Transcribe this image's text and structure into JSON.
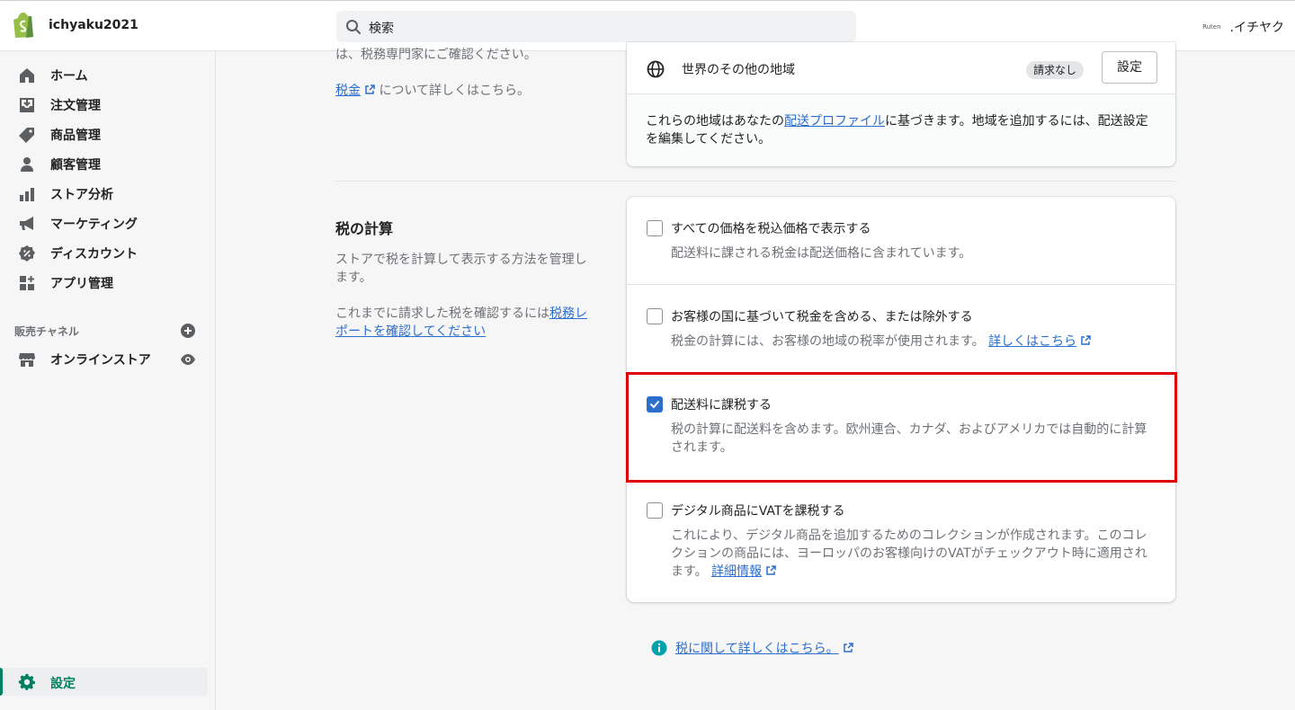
{
  "topbar": {
    "store_name": "ichyaku2021",
    "search_placeholder": "検索",
    "user_logo_text": "Ruten",
    "user_name": ".イチヤク"
  },
  "sidebar": {
    "items": [
      {
        "label": "ホーム",
        "icon": "home-icon"
      },
      {
        "label": "注文管理",
        "icon": "orders-icon"
      },
      {
        "label": "商品管理",
        "icon": "tag-icon"
      },
      {
        "label": "顧客管理",
        "icon": "customer-icon"
      },
      {
        "label": "ストア分析",
        "icon": "analytics-icon"
      },
      {
        "label": "マーケティング",
        "icon": "megaphone-icon"
      },
      {
        "label": "ディスカウント",
        "icon": "discount-icon"
      },
      {
        "label": "アプリ管理",
        "icon": "apps-icon"
      }
    ],
    "channels_title": "販売チャネル",
    "online_store": "オンラインストア",
    "settings": "設定"
  },
  "main": {
    "top_partial_text": "は、税務専門家にご確認ください。",
    "tax_link": "税金",
    "tax_link_suffix": "について詳しくはこちら。",
    "region": {
      "name": "世界のその他の地域",
      "badge": "請求なし",
      "button": "設定"
    },
    "region_note_pre": "これらの地域はあなたの",
    "region_note_link": "配送プロファイル",
    "region_note_post": "に基づきます。地域を追加するには、配送設定を編集してください。",
    "section_title": "税の計算",
    "section_desc": "ストアで税を計算して表示する方法を管理します。",
    "section_desc2_pre": "これまでに請求した税を確認するには",
    "section_desc2_link": "税務レポートを確認してください",
    "options": [
      {
        "label": "すべての価格を税込価格で表示する",
        "help": "配送料に課される税金は配送価格に含まれています。",
        "checked": false
      },
      {
        "label": "お客様の国に基づいて税金を含める、または除外する",
        "help": "税金の計算には、お客様の地域の税率が使用されます。",
        "link": "詳しくはこちら",
        "checked": false
      },
      {
        "label": "配送料に課税する",
        "help": "税の計算に配送料を含めます。欧州連合、カナダ、およびアメリカでは自動的に計算されます。",
        "checked": true
      },
      {
        "label": "デジタル商品にVATを課税する",
        "help": "これにより、デジタル商品を追加するためのコレクションが作成されます。このコレクションの商品には、ヨーロッパのお客様向けのVATがチェックアウト時に適用されます。",
        "link": "詳細情報",
        "checked": false
      }
    ],
    "footer_link": "税に関して詳しくはこちら。"
  },
  "colors": {
    "accent_green": "#008060",
    "link_blue": "#2c6ecb",
    "highlight_red": "#e00000"
  }
}
